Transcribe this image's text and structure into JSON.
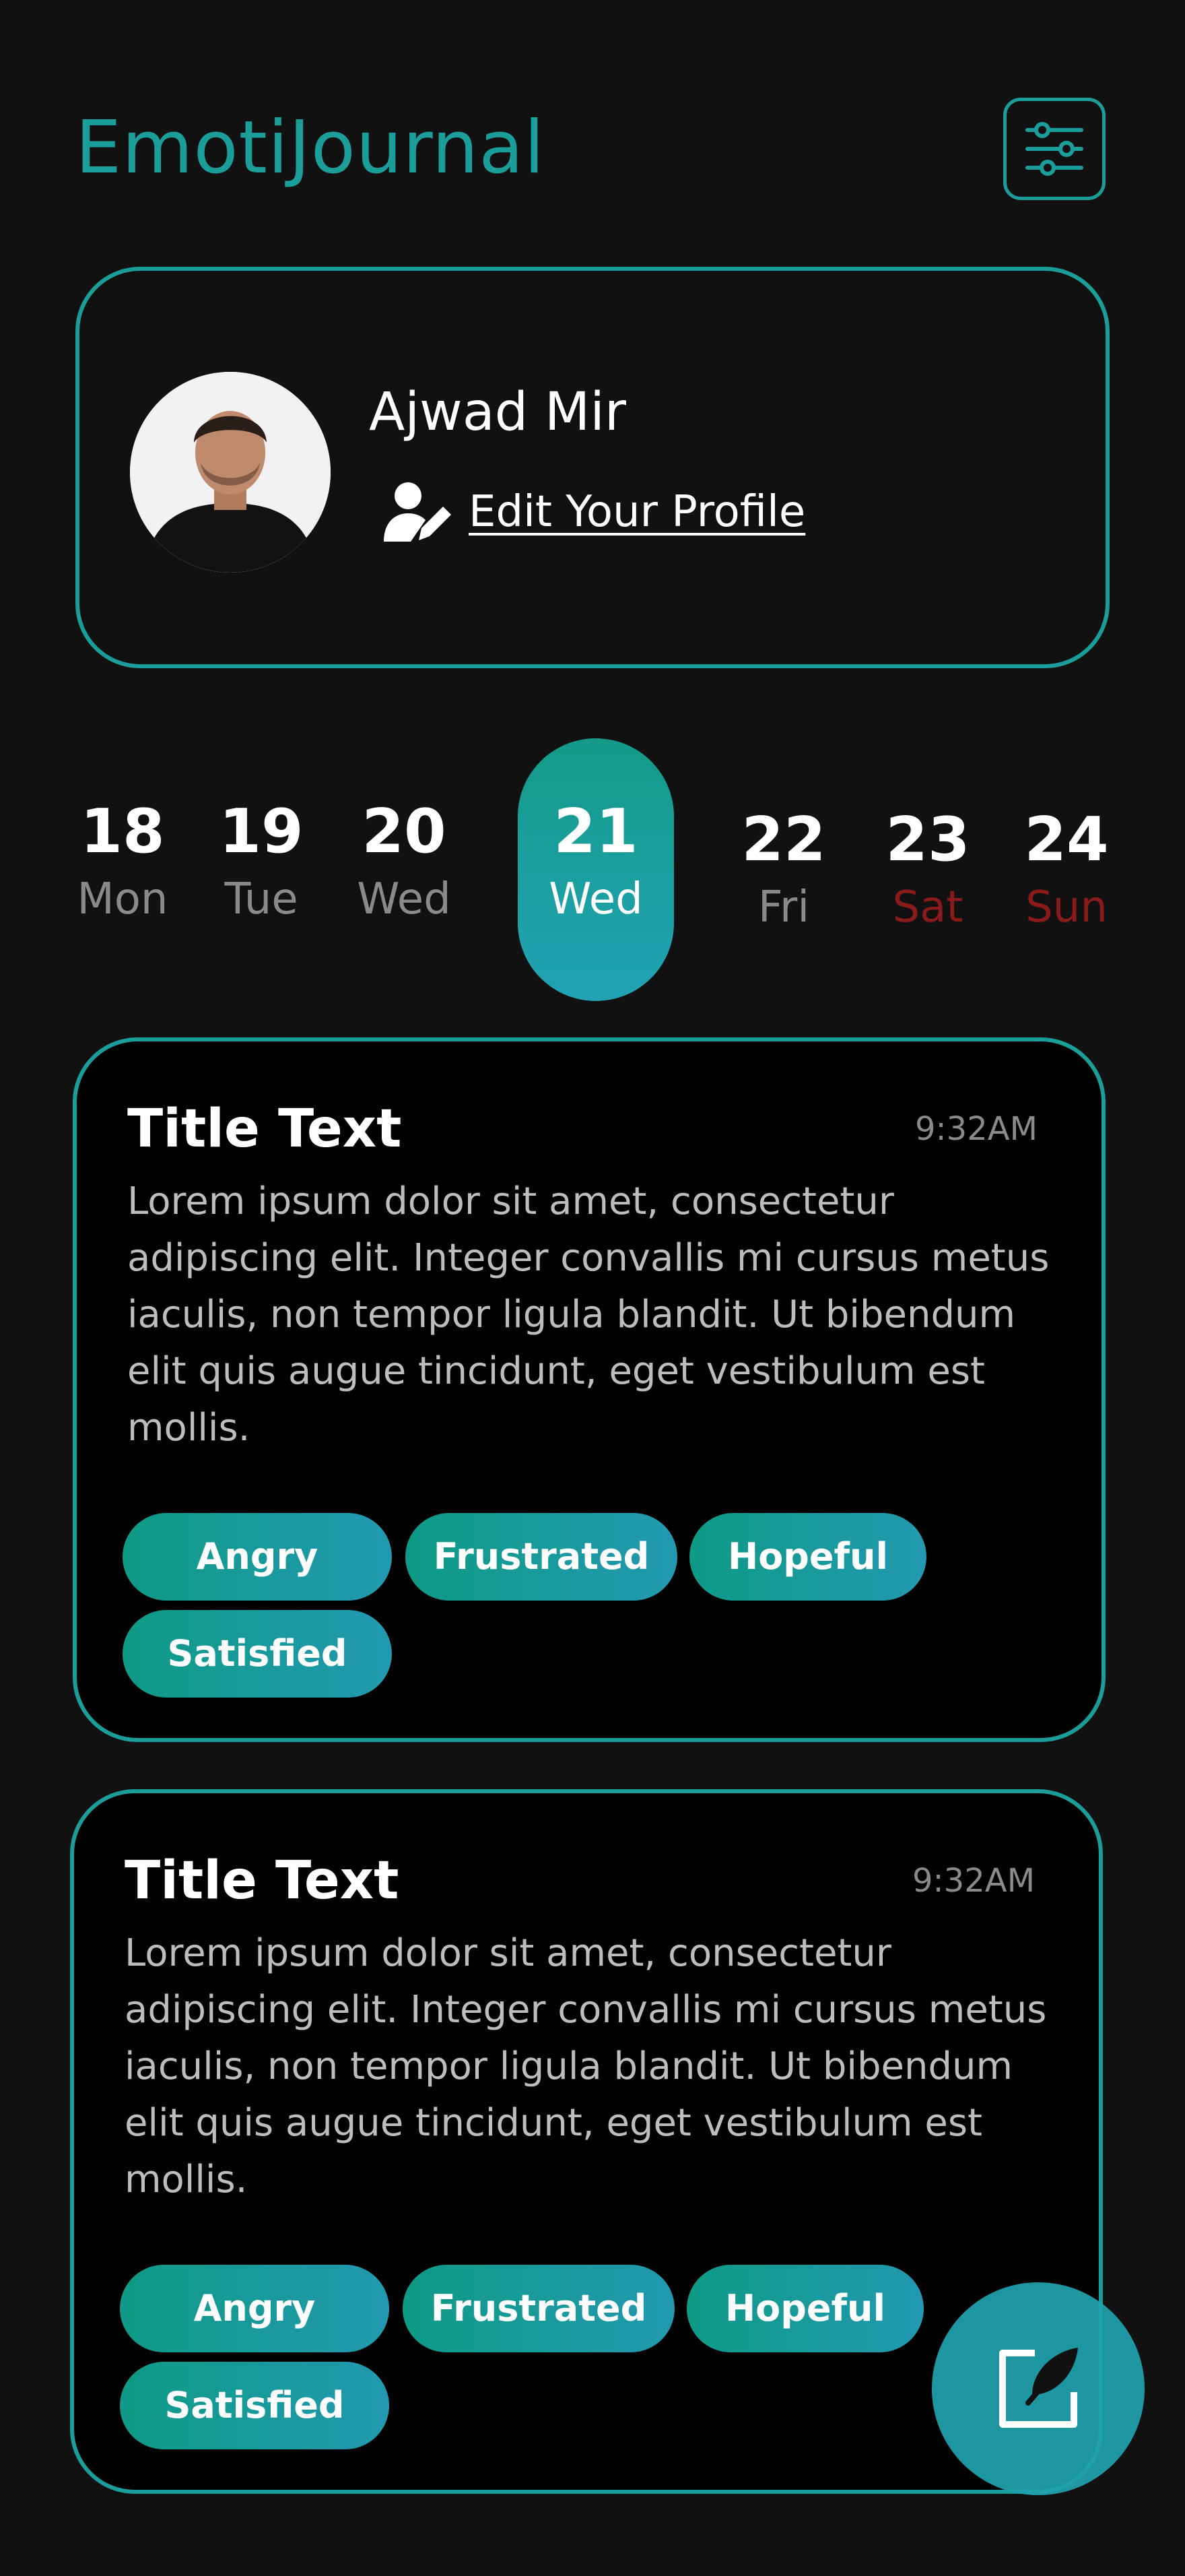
{
  "app": {
    "title": "EmotiJournal"
  },
  "header": {
    "settings_icon": "sliders-icon"
  },
  "profile": {
    "name": "Ajwad Mir",
    "edit_label": "Edit Your Profile",
    "edit_icon": "user-edit-icon",
    "avatar": "avatar"
  },
  "calendar": {
    "days": [
      {
        "num": "18",
        "name": "Mon"
      },
      {
        "num": "19",
        "name": "Tue"
      },
      {
        "num": "20",
        "name": "Wed"
      },
      {
        "num": "21",
        "name": "Wed",
        "selected": true
      },
      {
        "num": "22",
        "name": "Fri"
      },
      {
        "num": "23",
        "name": "Sat",
        "weekend": true
      },
      {
        "num": "24",
        "name": "Sun",
        "weekend": true
      }
    ]
  },
  "entries": [
    {
      "title": "Title Text",
      "time": "9:32AM",
      "body": "Lorem ipsum dolor sit amet, consectetur adipiscing elit. Integer convallis mi cursus metus iaculis, non tempor ligula blandit. Ut bibendum elit quis augue tincidunt, eget vestibulum est mollis.",
      "tags": [
        "Angry",
        "Frustrated",
        "Hopeful",
        "Satisfied"
      ]
    },
    {
      "title": "Title Text",
      "time": "9:32AM",
      "body": "Lorem ipsum dolor sit amet, consectetur adipiscing elit. Integer convallis mi cursus metus iaculis, non tempor ligula blandit. Ut bibendum elit quis augue tincidunt, eget vestibulum est mollis.",
      "tags": [
        "Angry",
        "Frustrated",
        "Hopeful",
        "Satisfied"
      ]
    }
  ],
  "fab": {
    "icon": "new-entry-icon"
  },
  "colors": {
    "accent": "#1b9e9a",
    "background": "#111111",
    "card": "#000000",
    "weekend": "#8b1a1a",
    "muted": "#8a8a8a"
  }
}
